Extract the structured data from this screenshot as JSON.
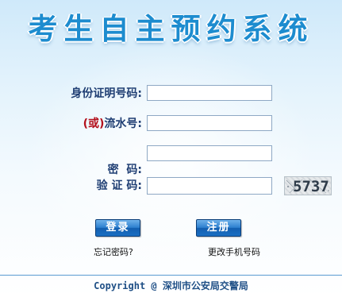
{
  "header": {
    "title": "考生自主预约系统"
  },
  "form": {
    "id_label": "身份证明号码:",
    "serial_or": "(或)",
    "serial_label": "流水号:",
    "password_label": "密  码:",
    "captcha_label": "验 证 码:",
    "id_value": "",
    "serial_value": "",
    "password_value": "",
    "captcha_value": "",
    "captcha_text": "5737"
  },
  "actions": {
    "login_label": "登录",
    "register_label": "注册",
    "forgot_password_link": "忘记密码?",
    "change_phone_link": "更改手机号码"
  },
  "footer": {
    "copyright": "Copyright @ 深圳市公安局交警局"
  },
  "colors": {
    "title": "#1d8ccf",
    "label": "#1f3e73",
    "or_text": "#b3101c",
    "button": "#1a6fc3",
    "footer_text": "#1f4f86"
  }
}
